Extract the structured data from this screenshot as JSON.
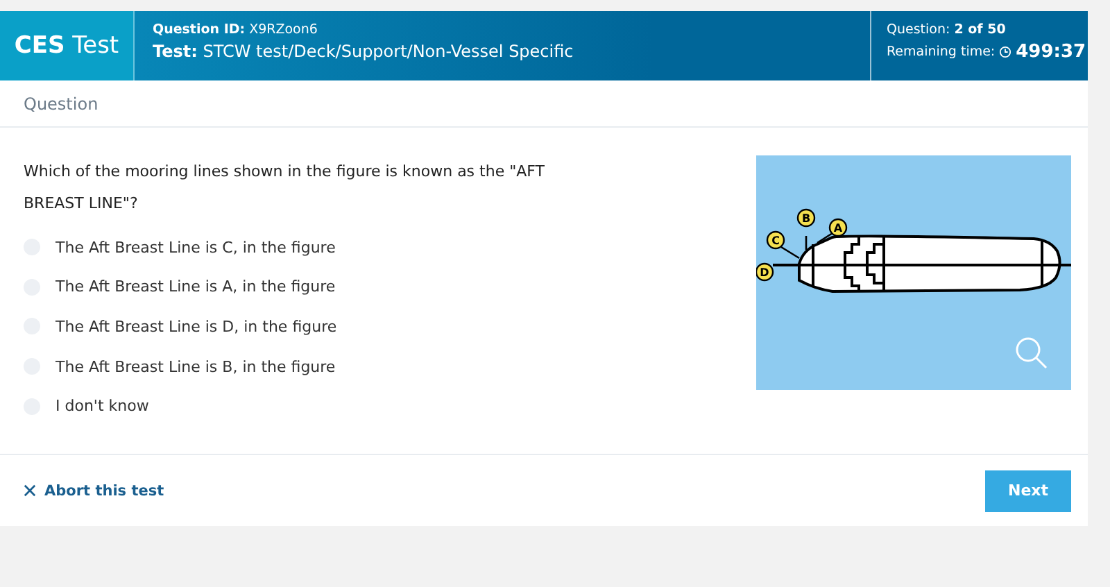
{
  "header": {
    "brand": "**CES** Test",
    "question_id": "**Question ID:** X9RZoon6",
    "test_path": "**Test:** STCW test/Deck/Support/Non-Vessel Specific",
    "progress": "Question: **2 of 50**",
    "time_label": "Remaining time:",
    "time": "499:37"
  },
  "section_title": "Question",
  "question": "Which of the mooring lines shown in the figure is known as the \"AFT BREAST LINE\"?",
  "options": [
    {
      "label": "The Aft Breast Line is C, in the figure",
      "selected": false
    },
    {
      "label": "The Aft Breast Line is A, in the figure",
      "selected": false
    },
    {
      "label": "The Aft Breast Line is D, in the figure",
      "selected": false
    },
    {
      "label": "The Aft Breast Line is B, in the figure",
      "selected": false
    },
    {
      "label": "I don't know",
      "selected": false
    }
  ],
  "figure_labels": [
    "A",
    "B",
    "C",
    "D"
  ],
  "footer": {
    "abort": "Abort this test",
    "next": "Next"
  }
}
